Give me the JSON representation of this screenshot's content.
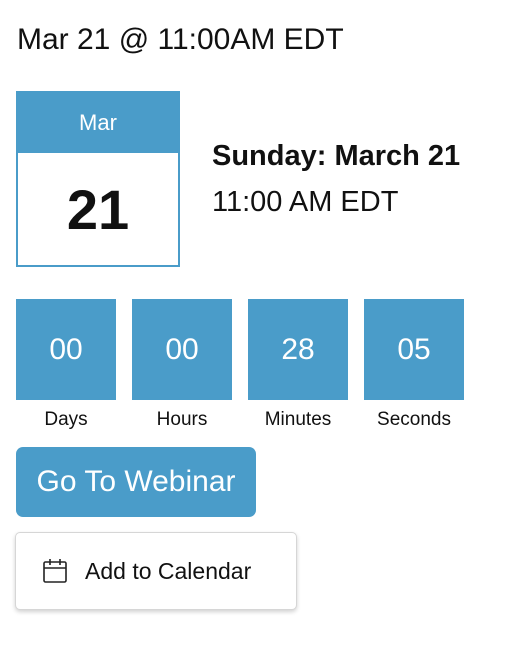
{
  "header": {
    "title": "Mar 21 @ 11:00AM EDT"
  },
  "date_card": {
    "month": "Mar",
    "day": "21"
  },
  "event": {
    "day_label": "Sunday: March 21",
    "time_label": "11:00 AM EDT"
  },
  "countdown": [
    {
      "value": "00",
      "label": "Days"
    },
    {
      "value": "00",
      "label": "Hours"
    },
    {
      "value": "28",
      "label": "Minutes"
    },
    {
      "value": "05",
      "label": "Seconds"
    }
  ],
  "actions": {
    "webinar_label": "Go To Webinar",
    "calendar_label": "Add to Calendar",
    "calendar_icon": "calendar-icon"
  },
  "colors": {
    "accent": "#4a9cc9",
    "text": "#111111",
    "on_accent": "#ffffff"
  }
}
